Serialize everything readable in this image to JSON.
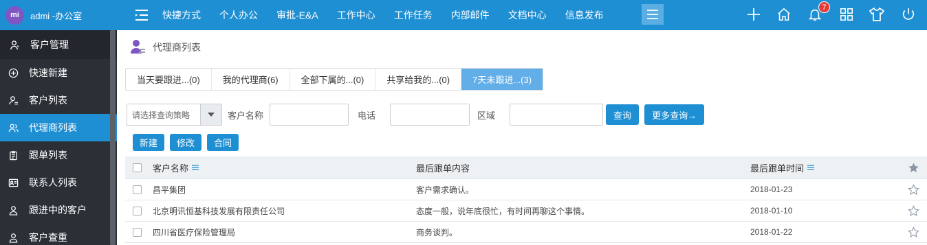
{
  "user": {
    "avatar_initials": "mi",
    "name": "admi -办公室"
  },
  "sidebar": {
    "module_title": "客户管理",
    "items": [
      {
        "label": "快速新建",
        "icon": "plus-circle-icon"
      },
      {
        "label": "客户列表",
        "icon": "user-list-icon"
      },
      {
        "label": "代理商列表",
        "icon": "agents-icon",
        "active": true
      },
      {
        "label": "跟单列表",
        "icon": "clipboard-icon"
      },
      {
        "label": "联系人列表",
        "icon": "contact-card-icon"
      },
      {
        "label": "跟进中的客户",
        "icon": "user-follow-icon"
      },
      {
        "label": "客户查重",
        "icon": "user-check-icon"
      }
    ]
  },
  "topnav": {
    "items": [
      "快捷方式",
      "个人办公",
      "审批-E&A",
      "工作中心",
      "工作任务",
      "内部邮件",
      "文档中心",
      "信息发布"
    ],
    "notification_count": "7"
  },
  "page": {
    "title": "代理商列表"
  },
  "tabs": [
    {
      "label": "当天要跟进...(0)"
    },
    {
      "label": "我的代理商(6)"
    },
    {
      "label": "全部下属的...(0)"
    },
    {
      "label": "共享给我的...(0)"
    },
    {
      "label": "7天未跟进...(3)",
      "active": true
    }
  ],
  "filters": {
    "strategy_placeholder": "请选择查询策略",
    "name_label": "客户名称",
    "phone_label": "电话",
    "region_label": "区域",
    "search_button": "查询",
    "more_button": "更多查询→"
  },
  "actions": {
    "new": "新建",
    "edit": "修改",
    "contract": "合同"
  },
  "table": {
    "columns": {
      "name": "客户名称",
      "content": "最后跟单内容",
      "time": "最后跟单时间"
    },
    "rows": [
      {
        "name": "昌平集团",
        "content": "客户需求确认。",
        "time": "2018-01-23"
      },
      {
        "name": "北京明讯恒基科技发展有限责任公司",
        "content": "态度一般，说年底很忙，有时间再聊这个事情。",
        "time": "2018-01-10"
      },
      {
        "name": "四川省医疗保险管理局",
        "content": "商务谈判。",
        "time": "2018-01-22"
      }
    ]
  },
  "colors": {
    "primary": "#1f8fd4",
    "sidebar_bg": "#2b3037",
    "tab_active": "#62aee8",
    "badge": "#e53935"
  }
}
